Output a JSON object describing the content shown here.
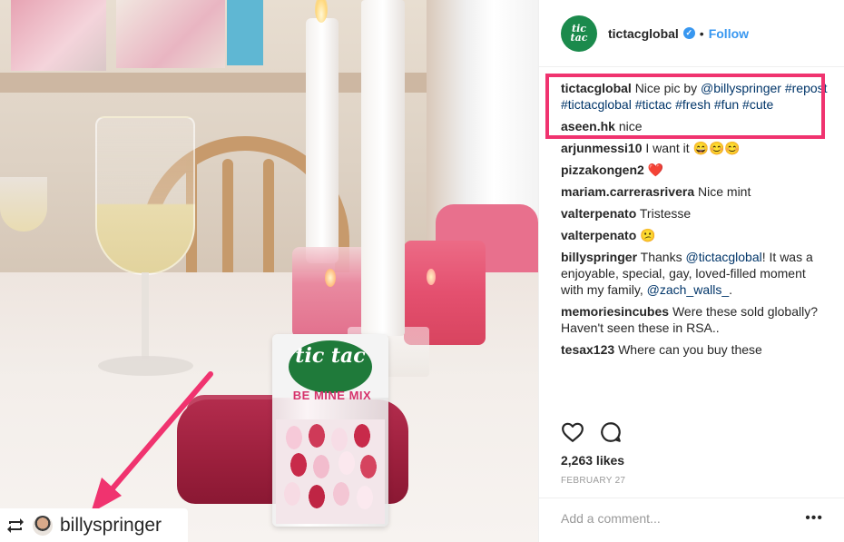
{
  "photo": {
    "repost": {
      "icon": "repost-icon",
      "username": "billyspringer"
    },
    "tictac": {
      "brand": "tic tac",
      "flavor": "BE MINE MIX"
    },
    "arrow_color": "#f0336f"
  },
  "header": {
    "username": "tictacglobal",
    "verified_icon": "verified-badge-icon",
    "separator": "•",
    "follow_label": "Follow"
  },
  "caption": {
    "username": "tictacglobal",
    "text_before": "Nice pic by",
    "mention": "@billyspringer",
    "hashtags": [
      "#repost",
      "#tictacglobal",
      "#tictac",
      "#fresh",
      "#fun",
      "#cute"
    ],
    "highlight_color": "#f0336f"
  },
  "comments": [
    {
      "username": "aseen.hk",
      "text": "nice"
    },
    {
      "username": "arjunmessi10",
      "text": "I want it 😄😊😊"
    },
    {
      "username": "pizzakongen2",
      "text": "❤️"
    },
    {
      "username": "mariam.carrerasrivera",
      "text": "Nice mint"
    },
    {
      "username": "valterpenato",
      "text": "Tristesse"
    },
    {
      "username": "valterpenato",
      "text": "😕"
    },
    {
      "username": "billyspringer",
      "text_before": "Thanks",
      "mention1": "@tictacglobal",
      "text_middle": "! It was a enjoyable, special, gay, loved-filled moment with my family,",
      "mention2": "@zach_walls_",
      "text_after": "."
    },
    {
      "username": "memoriesincubes",
      "text": "Were these sold globally? Haven't seen these in RSA.."
    },
    {
      "username": "tesax123",
      "text": "Where can you buy these"
    }
  ],
  "actions": {
    "like_icon": "heart-icon",
    "comment_icon": "comment-bubble-icon"
  },
  "likes": "2,263 likes",
  "date": "FEBRUARY 27",
  "comment_box": {
    "placeholder": "Add a comment...",
    "more_label": "•••"
  },
  "colors": {
    "link": "#003569",
    "accent": "#3897f0",
    "brand_green": "#1b8a4c"
  }
}
